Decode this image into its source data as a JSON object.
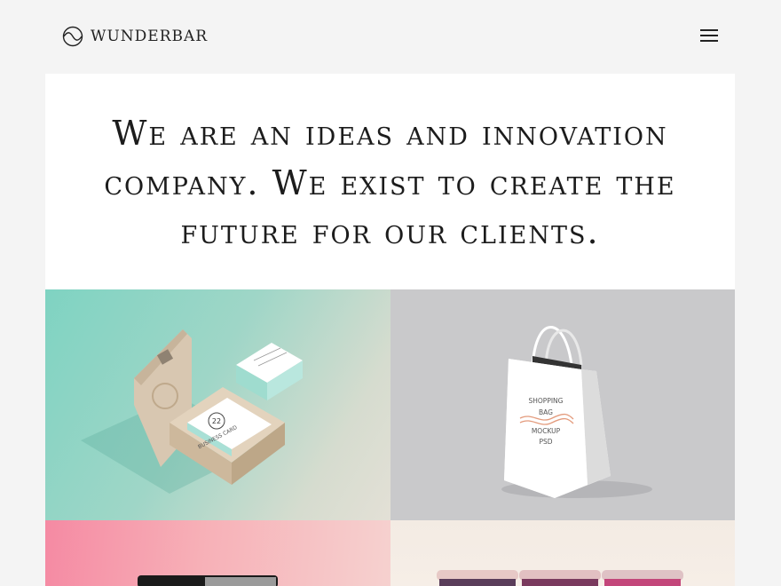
{
  "header": {
    "brand": "WUNDERBAR",
    "icons": {
      "logo": "wave-circle-logo",
      "menu": "hamburger-menu-icon"
    }
  },
  "hero": {
    "headline_lines": [
      "We are an ideas and innovation",
      "company. We exist to create the",
      "future for our clients."
    ]
  },
  "portfolio": {
    "tiles": [
      {
        "subject": "business-card-box"
      },
      {
        "subject": "shopping-bag"
      },
      {
        "subject": "laptop"
      },
      {
        "subject": "cups"
      }
    ],
    "card_text": {
      "number": "22",
      "line1": "BUSINESS CARD"
    },
    "bag_text": {
      "word1": "SHOPPING",
      "word2": "BAG",
      "word3": "MOCKUP",
      "word4": "PSD"
    }
  },
  "colors": {
    "background": "#f4f4f4",
    "panel": "#ffffff",
    "text": "#1c1c1c",
    "mint": "#7fd3c2",
    "grey": "#c9c9cb",
    "pink": "#f58aa3",
    "cream": "#f3ebe3"
  }
}
